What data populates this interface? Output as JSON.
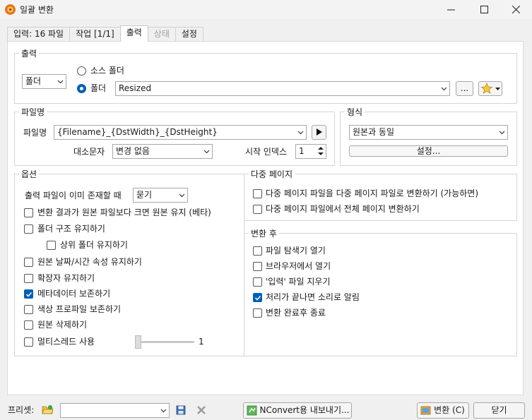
{
  "window": {
    "title": "일괄 변환",
    "minimize_icon": "minimize-icon",
    "maximize_icon": "maximize-icon",
    "close_icon": "close-icon"
  },
  "tabs": [
    {
      "label": "입력: 16 파일",
      "state": "normal"
    },
    {
      "label": "작업 [1/1]",
      "state": "normal"
    },
    {
      "label": "출력",
      "state": "active"
    },
    {
      "label": "상태",
      "state": "disabled"
    },
    {
      "label": "설정",
      "state": "normal"
    }
  ],
  "output": {
    "title": "출력",
    "mode_value": "폴더",
    "source_folder_label": "소스 폴더",
    "folder_label": "폴더",
    "folder_value": "Resized",
    "browse_label": "...",
    "favorites_icon": "star-icon"
  },
  "filename": {
    "title": "파일명",
    "label": "파일명",
    "pattern": "{Filename}_{DstWidth}_{DstHeight}",
    "case_label": "대소문자",
    "case_value": "변경 없음",
    "start_index_label": "시작 인덱스",
    "start_index_value": "1"
  },
  "format": {
    "title": "형식",
    "value": "원본과 동일",
    "settings_label": "설정..."
  },
  "options": {
    "title": "옵션",
    "exists_label": "출력 파일이 이미 존재할 때",
    "exists_value": "묻기",
    "keep_original_if_larger": "변환 결과가 원본 파일보다 크면 원본 유지 (베타)",
    "keep_folder_structure": "폴더 구조 유지하기",
    "keep_parent_folder": "상위 폴더 유지하기",
    "keep_date_time": "원본 날짜/시간 속성 유지하기",
    "keep_extension": "확장자 유지하기",
    "keep_metadata": "메타데이터 보존하기",
    "keep_color_profile": "색상 프로파일 보존하기",
    "delete_original": "원본 삭제하기",
    "multithread": "멀티스레드 사용",
    "multithread_value": "1",
    "multithread_level": 0
  },
  "multipage": {
    "title": "다중 페이지",
    "to_multipage": "다중 페이지 파일을 다중 페이지 파일로 변환하기 (가능하면)",
    "all_pages": "다중 페이지 파일에서 전체 페이지 변환하기"
  },
  "after": {
    "title": "변환 후",
    "open_explorer": "파일 탐색기 열기",
    "open_browser": "브라우저에서 열기",
    "clear_input": "'입력' 파일 지우기",
    "sound": "처리가 끝나면 소리로 알림",
    "close_when_done": "변환 완료후 종료"
  },
  "footer": {
    "preset_label": "프리셋:",
    "preset_value": "",
    "nconvert_label": "NConvert용 내보내기...",
    "convert_label": "변환 (C)",
    "close_label": "닫기"
  }
}
